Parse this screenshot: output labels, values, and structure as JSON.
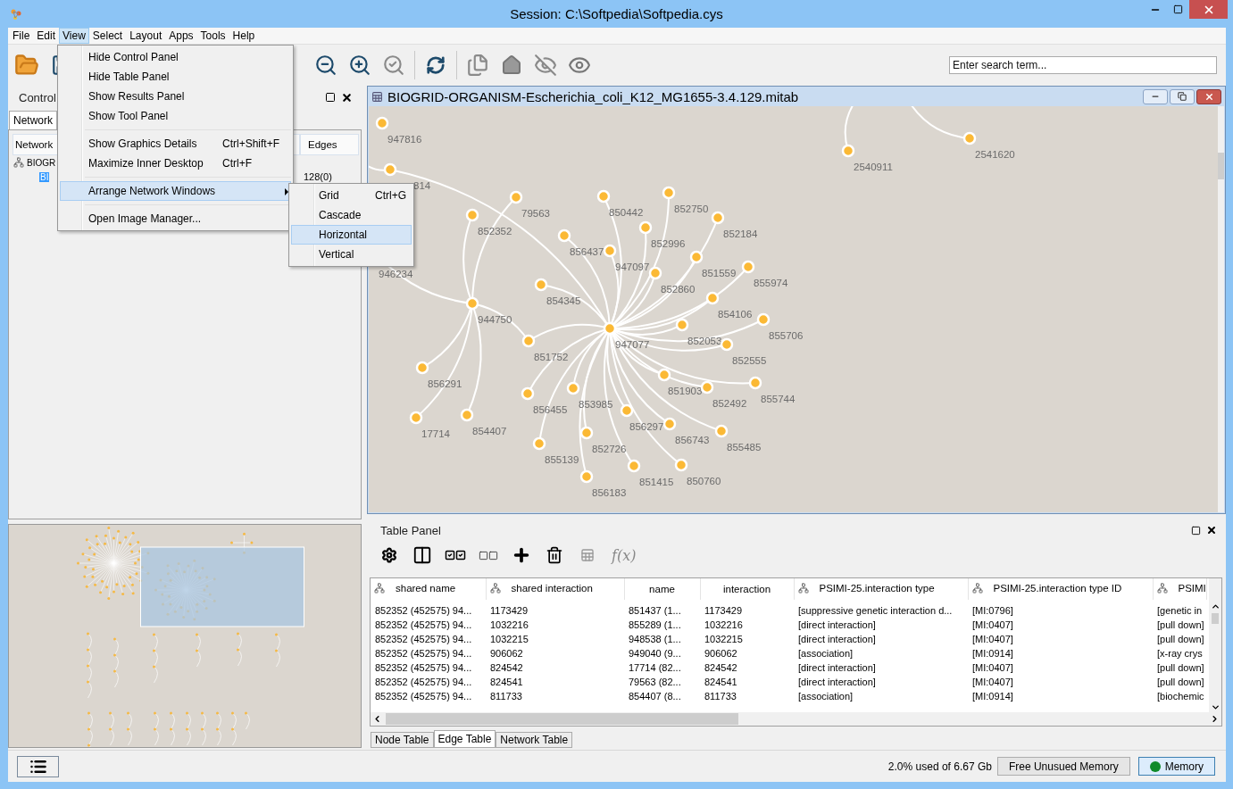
{
  "window": {
    "title": "Session: C:\\Softpedia\\Softpedia.cys"
  },
  "menu_bar": [
    {
      "label": "File",
      "selected": false
    },
    {
      "label": "Edit",
      "selected": false
    },
    {
      "label": "View",
      "selected": true
    },
    {
      "label": "Select",
      "selected": false
    },
    {
      "label": "Layout",
      "selected": false
    },
    {
      "label": "Apps",
      "selected": false
    },
    {
      "label": "Tools",
      "selected": false
    },
    {
      "label": "Help",
      "selected": false
    }
  ],
  "view_menu": [
    {
      "kind": "item",
      "label": "Hide Control Panel",
      "highlighted": false
    },
    {
      "kind": "item",
      "label": "Hide Table Panel",
      "highlighted": false
    },
    {
      "kind": "item",
      "label": "Show Results Panel",
      "highlighted": false
    },
    {
      "kind": "item",
      "label": "Show Tool Panel",
      "highlighted": false
    },
    {
      "kind": "separator"
    },
    {
      "kind": "item",
      "label": "Show Graphics Details",
      "shortcut": "Ctrl+Shift+F",
      "highlighted": false
    },
    {
      "kind": "item",
      "label": "Maximize Inner Desktop",
      "shortcut": "Ctrl+F",
      "highlighted": false
    },
    {
      "kind": "separator"
    },
    {
      "kind": "submenu",
      "label": "Arrange Network Windows",
      "highlighted": true
    },
    {
      "kind": "separator"
    },
    {
      "kind": "item",
      "label": "Open Image Manager...",
      "highlighted": false
    }
  ],
  "submenu": [
    {
      "label": "Grid",
      "shortcut": "Ctrl+G",
      "highlighted": false
    },
    {
      "label": "Cascade",
      "highlighted": false
    },
    {
      "label": "Horizontal",
      "highlighted": true
    },
    {
      "label": "Vertical",
      "highlighted": false
    }
  ],
  "search": {
    "placeholder": "Enter search term..."
  },
  "control_panel": {
    "title": "Control",
    "tabs": [
      {
        "label": "Network",
        "selected": true
      }
    ],
    "columns": [
      "Network",
      "Edges"
    ],
    "tree": [
      {
        "label": "BIOGR",
        "selected": false,
        "children": [
          {
            "label": "BI",
            "selected": true,
            "edges": "128(0)"
          }
        ]
      }
    ]
  },
  "network_window": {
    "title": "BIOGRID-ORGANISM-Escherichia_coli_K12_MG1655-3.4.129.mitab",
    "nodes": [
      {
        "kind": "node",
        "label": "947816"
      },
      {
        "kind": "node",
        "label": "814"
      },
      {
        "kind": "node",
        "label": "2540911"
      },
      {
        "kind": "node",
        "label": "2541620"
      },
      {
        "kind": "node",
        "label": "79563"
      },
      {
        "kind": "node",
        "label": "850442"
      },
      {
        "kind": "node",
        "label": "852750"
      },
      {
        "kind": "node",
        "label": "852352"
      },
      {
        "kind": "node",
        "label": "852184"
      },
      {
        "kind": "node",
        "label": "852996"
      },
      {
        "kind": "node",
        "label": "856437"
      },
      {
        "kind": "node",
        "label": "947097"
      },
      {
        "kind": "node",
        "label": "851559"
      },
      {
        "kind": "node",
        "label": "855974"
      },
      {
        "kind": "label",
        "label": "946234"
      },
      {
        "kind": "node",
        "label": "852860"
      },
      {
        "kind": "node",
        "label": "854345"
      },
      {
        "kind": "node",
        "label": "944750"
      },
      {
        "kind": "node",
        "label": "854106"
      },
      {
        "kind": "node",
        "label": "855706"
      },
      {
        "kind": "node",
        "label": "947077"
      },
      {
        "kind": "node",
        "label": "852053"
      },
      {
        "kind": "node",
        "label": "852555"
      },
      {
        "kind": "node",
        "label": "851752"
      },
      {
        "kind": "node",
        "label": "856291"
      },
      {
        "kind": "node",
        "label": "851903"
      },
      {
        "kind": "node",
        "label": "855744"
      },
      {
        "kind": "node",
        "label": "852492"
      },
      {
        "kind": "node",
        "label": "856455"
      },
      {
        "kind": "node",
        "label": "853985"
      },
      {
        "kind": "node",
        "label": "17714"
      },
      {
        "kind": "node",
        "label": "854407"
      },
      {
        "kind": "node",
        "label": "856297"
      },
      {
        "kind": "node",
        "label": "856743"
      },
      {
        "kind": "node",
        "label": "855485"
      },
      {
        "kind": "node",
        "label": "852726"
      },
      {
        "kind": "node",
        "label": "855139"
      },
      {
        "kind": "node",
        "label": "851415"
      },
      {
        "kind": "node",
        "label": "850760"
      },
      {
        "kind": "node",
        "label": "856183"
      }
    ]
  },
  "table_panel": {
    "title": "Table Panel",
    "formula_button": "f(x)",
    "columns": [
      {
        "label": "shared name",
        "shared": true
      },
      {
        "label": "shared interaction",
        "shared": true
      },
      {
        "label": "name",
        "shared": false
      },
      {
        "label": "interaction",
        "shared": false
      },
      {
        "label": "PSIMI-25.interaction type",
        "shared": true
      },
      {
        "label": "PSIMI-25.interaction type ID",
        "shared": true
      },
      {
        "label": "PSIMI",
        "shared": true
      }
    ],
    "rows": [
      [
        "852352 (452575) 94...",
        "1173429",
        "851437 (1...",
        "1173429",
        "[suppressive genetic interaction d...",
        "[MI:0796]",
        "[genetic in"
      ],
      [
        "852352 (452575) 94...",
        "1032216",
        "855289 (1...",
        "1032216",
        "[direct interaction]",
        "[MI:0407]",
        "[pull down]"
      ],
      [
        "852352 (452575) 94...",
        "1032215",
        "948538 (1...",
        "1032215",
        "[direct interaction]",
        "[MI:0407]",
        "[pull down]"
      ],
      [
        "852352 (452575) 94...",
        "906062",
        "949040 (9...",
        "906062",
        "[association]",
        "[MI:0914]",
        "[x-ray crys"
      ],
      [
        "852352 (452575) 94...",
        "824542",
        "17714 (82...",
        "824542",
        "[direct interaction]",
        "[MI:0407]",
        "[pull down]"
      ],
      [
        "852352 (452575) 94...",
        "824541",
        "79563 (82...",
        "824541",
        "[direct interaction]",
        "[MI:0407]",
        "[pull down]"
      ],
      [
        "852352 (452575) 94...",
        "811733",
        "854407 (8...",
        "811733",
        "[association]",
        "[MI:0914]",
        "[biochemic"
      ]
    ],
    "tabs": [
      {
        "label": "Node Table",
        "selected": false
      },
      {
        "label": "Edge Table",
        "selected": true
      },
      {
        "label": "Network Table",
        "selected": false
      }
    ]
  },
  "status_bar": {
    "memory_usage": "2.0% used of 6.67 Gb",
    "free_memory_button": "Free Unusued Memory",
    "memory_button": "Memory"
  }
}
